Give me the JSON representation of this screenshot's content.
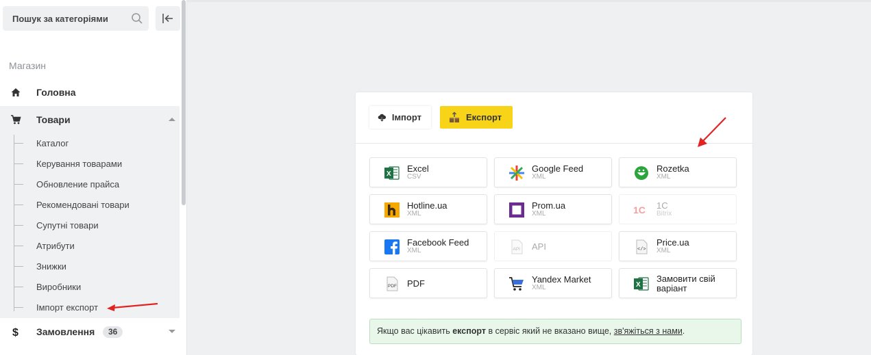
{
  "sidebar": {
    "search": {
      "placeholder": "Пошук за категоріями"
    },
    "section_label": "Магазин",
    "home": {
      "label": "Головна"
    },
    "goods": {
      "label": "Товари",
      "children": [
        "Каталог",
        "Керування товарами",
        "Обновление прайса",
        "Рекомендовані товари",
        "Супутні товари",
        "Атрибути",
        "Знижки",
        "Виробники",
        "Імпорт експорт"
      ]
    },
    "orders": {
      "label": "Замовлення",
      "count": "36"
    }
  },
  "main": {
    "tabs": [
      {
        "label": "Імпорт",
        "icon": "cloud-download-icon",
        "active": false
      },
      {
        "label": "Експорт",
        "icon": "box-upload-icon",
        "active": true
      }
    ],
    "tiles": [
      {
        "name": "Excel",
        "sub": "CSV",
        "icon": "excel-icon"
      },
      {
        "name": "Google Feed",
        "sub": "XML",
        "icon": "google-feed-icon"
      },
      {
        "name": "Rozetka",
        "sub": "XML",
        "icon": "rozetka-icon"
      },
      {
        "name": "Hotline.ua",
        "sub": "XML",
        "icon": "hotline-icon"
      },
      {
        "name": "Prom.ua",
        "sub": "XML",
        "icon": "prom-icon"
      },
      {
        "name": "1C",
        "sub": "Bitrix",
        "icon": "onec-icon"
      },
      {
        "name": "Facebook Feed",
        "sub": "XML",
        "icon": "facebook-icon"
      },
      {
        "name": "API",
        "sub": "",
        "icon": "api-file-icon"
      },
      {
        "name": "Price.ua",
        "sub": "XML",
        "icon": "code-file-icon"
      },
      {
        "name": "PDF",
        "sub": "",
        "icon": "pdf-file-icon"
      },
      {
        "name": "Yandex Market",
        "sub": "XML",
        "icon": "cart-icon"
      },
      {
        "name": "Замовити свій варіант",
        "sub": "",
        "icon": "excel-icon"
      }
    ],
    "notice": {
      "before": "Якщо вас цікавить ",
      "bold": "експорт",
      "middle": " в сервіс який не вказано вище, ",
      "link": "зв'яжіться з нами",
      "after": "."
    }
  },
  "colors": {
    "accent": "#f7d417",
    "excel": "#1f7244",
    "facebook": "#1877f2",
    "prom": "#6a2c91",
    "hotline": "#f5a800",
    "rozetka": "#2ca53c",
    "arrow": "#e02424",
    "notice_bg": "#e9f7ea"
  }
}
